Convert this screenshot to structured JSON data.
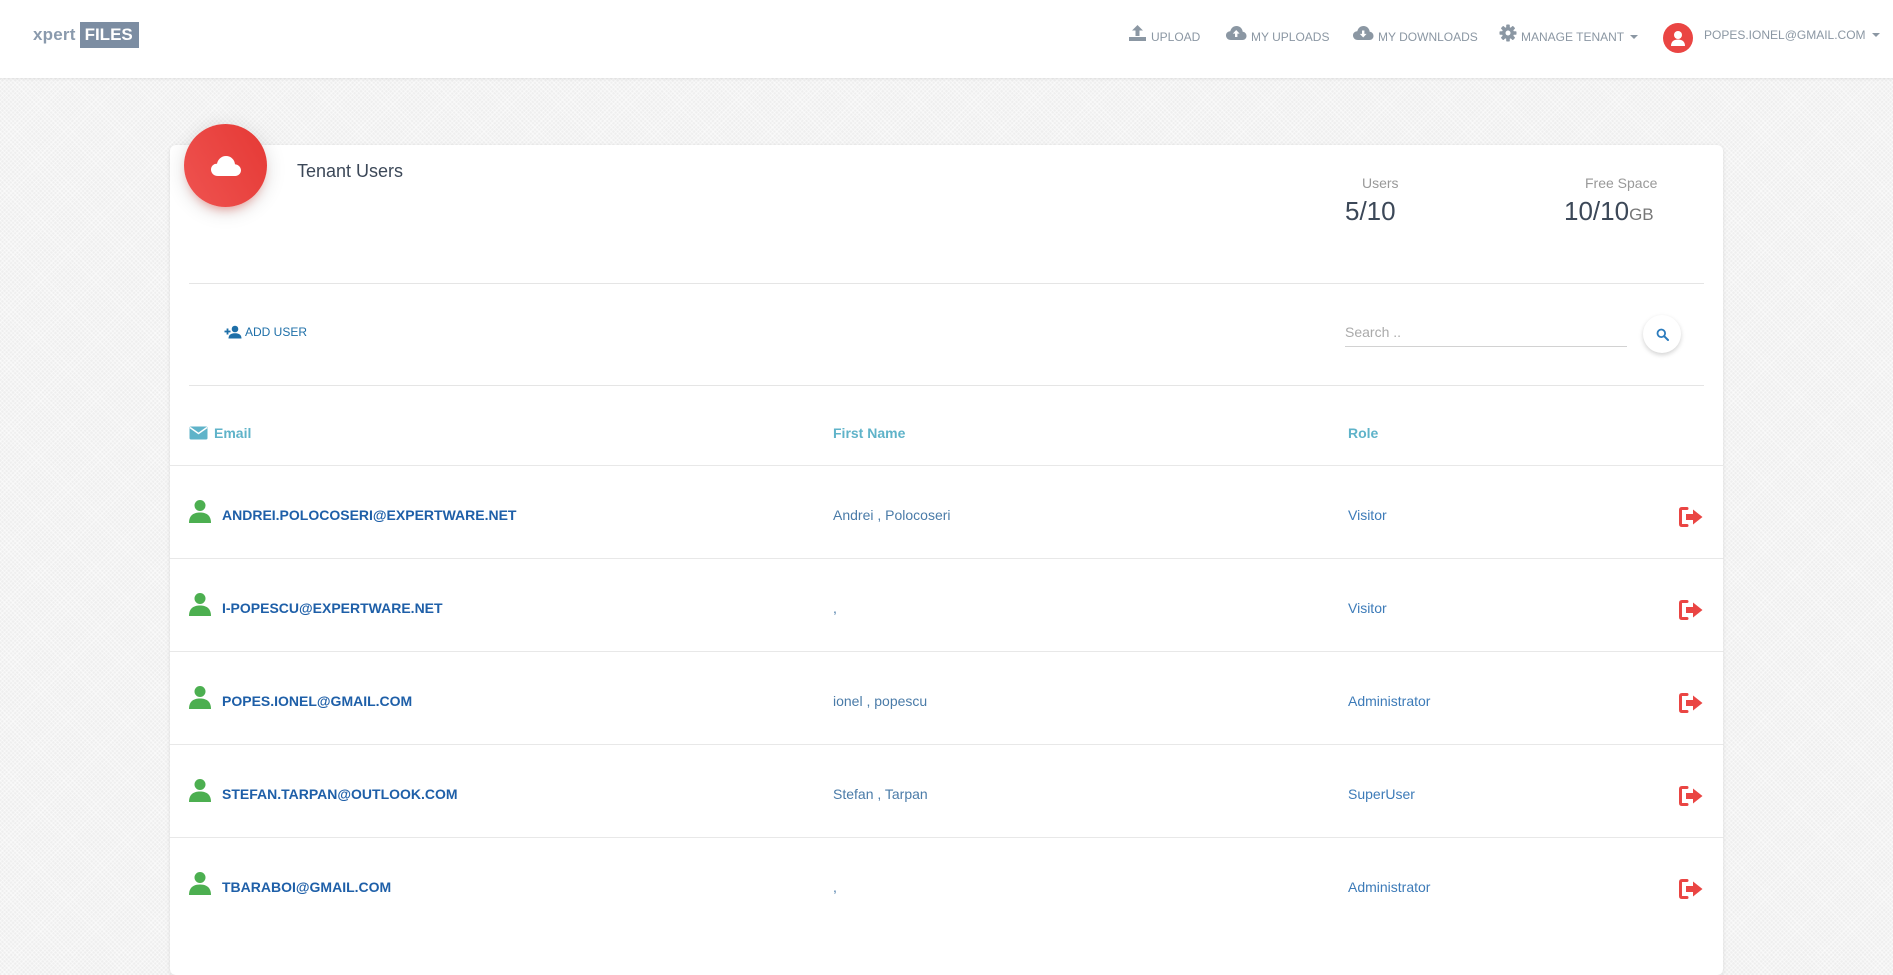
{
  "brand": {
    "part1": "xpert",
    "part2": "FILES"
  },
  "nav": {
    "upload": "UPLOAD",
    "my_uploads": "MY UPLOADS",
    "my_downloads": "MY DOWNLOADS",
    "manage_tenant": "MANAGE TENANT",
    "user_email": "POPES.IONEL@GMAIL.COM"
  },
  "card": {
    "title": "Tenant Users",
    "users_label": "Users",
    "users_value": "5/10",
    "space_label": "Free Space",
    "space_value": "10/10",
    "space_unit": "GB"
  },
  "toolbar": {
    "add_user": "ADD USER",
    "search_placeholder": "Search .."
  },
  "table": {
    "headers": {
      "email": "Email",
      "first_name": "First Name",
      "role": "Role"
    },
    "rows": [
      {
        "email": "ANDREI.POLOCOSERI@EXPERTWARE.NET",
        "name": "Andrei , Polocoseri",
        "role": "Visitor"
      },
      {
        "email": "I-POPESCU@EXPERTWARE.NET",
        "name": ",",
        "role": "Visitor"
      },
      {
        "email": "POPES.IONEL@GMAIL.COM",
        "name": "ionel , popescu",
        "role": "Administrator"
      },
      {
        "email": "STEFAN.TARPAN@OUTLOOK.COM",
        "name": "Stefan , Tarpan",
        "role": "SuperUser"
      },
      {
        "email": "TBARABOI@GMAIL.COM",
        "name": ",",
        "role": "Administrator"
      }
    ]
  },
  "colors": {
    "accent_red": "#ea4543",
    "link_blue": "#1e5fa8",
    "header_teal": "#5fb3c9",
    "user_green": "#4caf50"
  },
  "icons": {
    "upload": "upload-icon",
    "my_uploads": "cloud-upload-icon",
    "my_downloads": "cloud-download-icon",
    "manage_tenant": "gear-icon",
    "user_avatar": "user-avatar-icon",
    "card": "cloud-icon",
    "add_user": "add-user-icon",
    "search": "search-icon",
    "email_header": "envelope-icon",
    "row_user": "user-icon",
    "row_action": "sign-out-icon"
  }
}
